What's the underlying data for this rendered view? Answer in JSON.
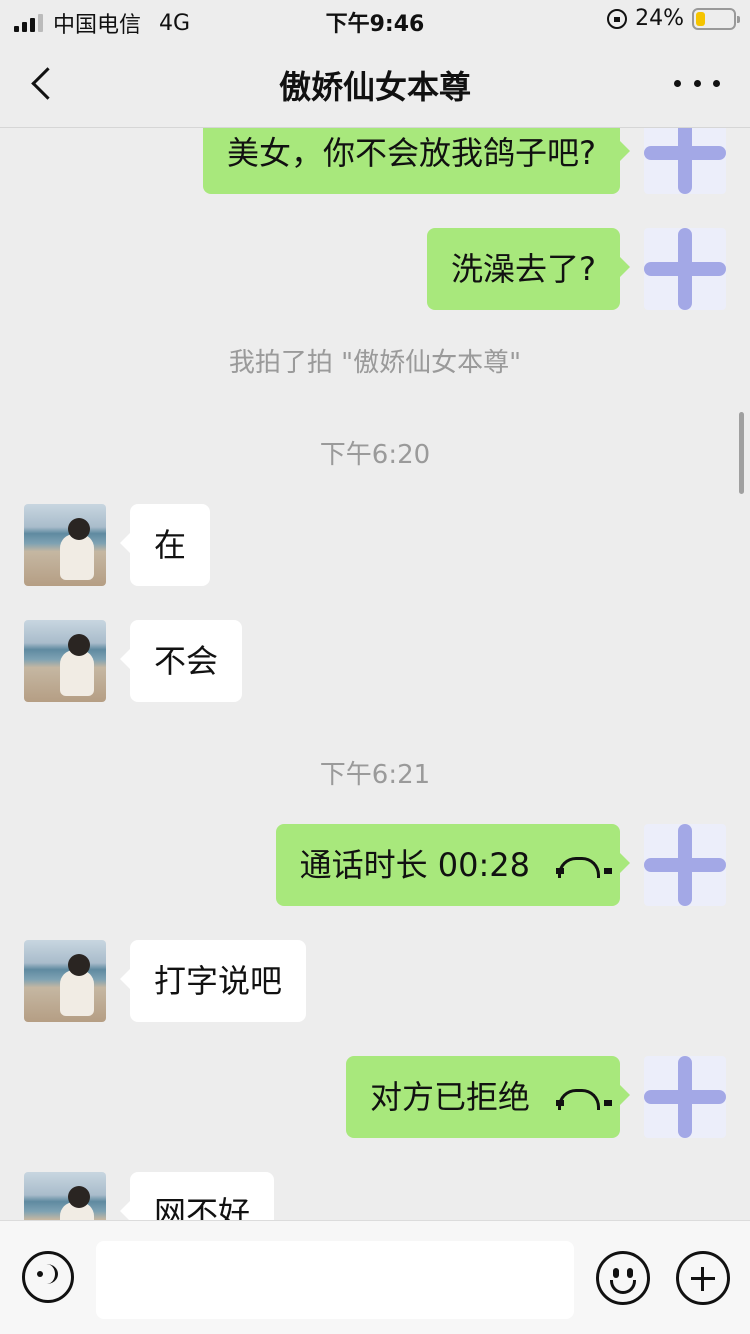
{
  "status_bar": {
    "carrier": "中国电信",
    "network": "4G",
    "time": "下午9:46",
    "battery": "24%",
    "battery_level": 0.24
  },
  "header": {
    "title": "傲娇仙女本尊"
  },
  "messages": [
    {
      "type": "self",
      "text": "美女，你不会放我鸽子吧?"
    },
    {
      "type": "self",
      "text": "洗澡去了?"
    },
    {
      "type": "system",
      "text": "我拍了拍 \"傲娇仙女本尊\""
    },
    {
      "type": "timestamp",
      "text": "下午6:20"
    },
    {
      "type": "other",
      "text": "在"
    },
    {
      "type": "other",
      "text": "不会"
    },
    {
      "type": "timestamp",
      "text": "下午6:21"
    },
    {
      "type": "self-call",
      "text": "通话时长 00:28"
    },
    {
      "type": "other",
      "text": "打字说吧"
    },
    {
      "type": "self-call",
      "text": "对方已拒绝"
    },
    {
      "type": "other",
      "text": "网不好"
    }
  ],
  "input_bar": {
    "placeholder": ""
  },
  "icons": {
    "back": "chevron-left-icon",
    "more": "more-dots-icon",
    "voice": "voice-icon",
    "emoji": "emoji-icon",
    "plus": "plus-icon",
    "call": "phone-hangup-icon"
  },
  "colors": {
    "self_bubble": "#a8e87c",
    "other_bubble": "#ffffff",
    "background": "#ededed"
  }
}
